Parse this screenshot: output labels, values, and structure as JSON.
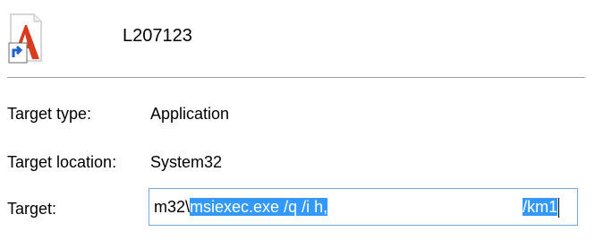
{
  "header": {
    "shortcut_name": "L207123",
    "icon": "shortcut-app-icon"
  },
  "fields": {
    "target_type_label": "Target type:",
    "target_type_value": "Application",
    "target_location_label": "Target location:",
    "target_location_value": "System32",
    "target_label": "Target:",
    "target_prefix": "m32\\",
    "target_selected_start": "msiexec.exe /q /i h",
    "target_selected_mid": ",",
    "target_selected_end": "/km1"
  },
  "colors": {
    "selection": "#3399ff",
    "field_border": "#7aa7d8"
  }
}
